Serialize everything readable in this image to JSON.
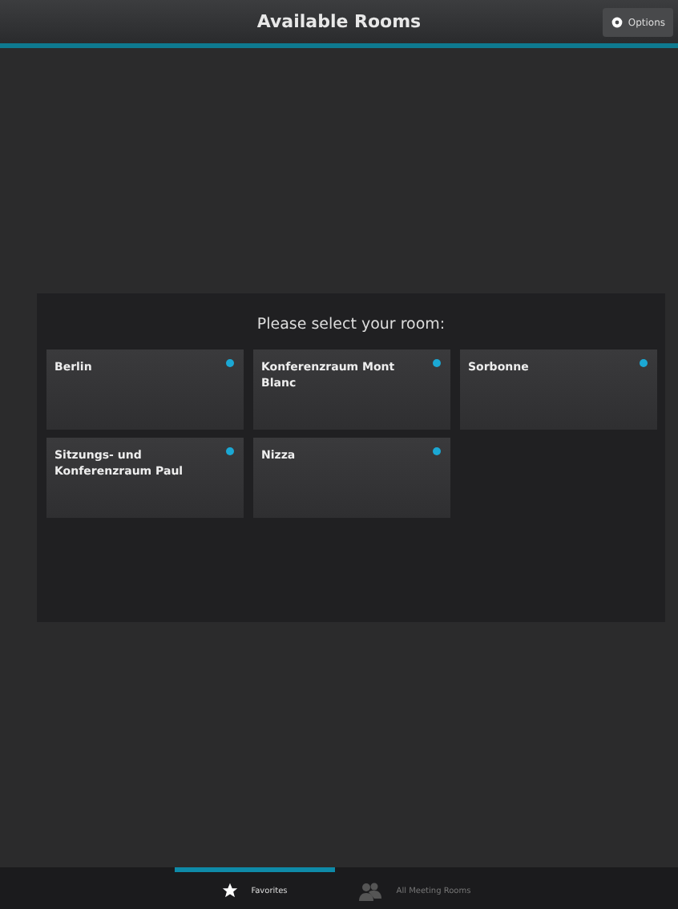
{
  "header": {
    "title": "Available Rooms",
    "options_button": "Options"
  },
  "panel": {
    "prompt": "Please select your room:",
    "rooms": [
      {
        "name": "Berlin"
      },
      {
        "name": "Konferenzraum Mont Blanc"
      },
      {
        "name": "Sorbonne"
      },
      {
        "name": "Sitzungs- und Konferenzraum Paul"
      },
      {
        "name": "Nizza"
      }
    ]
  },
  "tabs": [
    {
      "label": "Favorites",
      "kind": "star",
      "selected": true
    },
    {
      "label": "All Meeting Rooms",
      "kind": "people",
      "selected": false
    }
  ]
}
